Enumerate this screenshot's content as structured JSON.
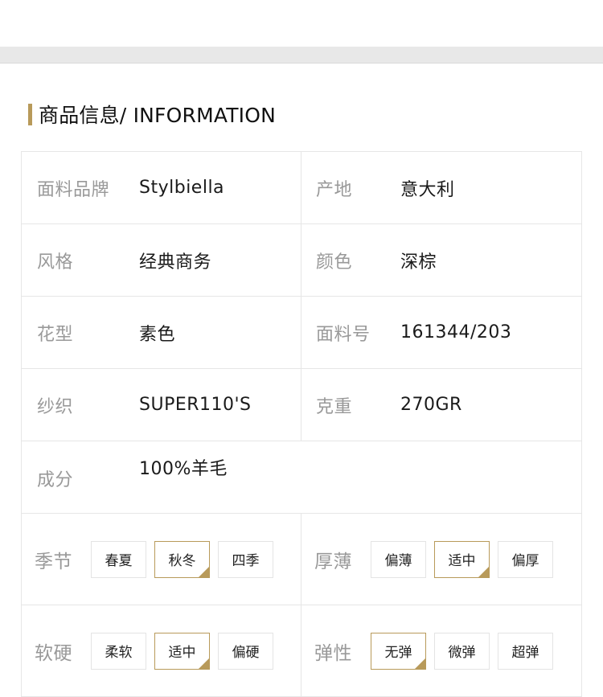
{
  "section": {
    "title": "商品信息/ INFORMATION"
  },
  "colors": {
    "accent": "#b89a5a",
    "label": "#999999",
    "value": "#1a1a1a",
    "border": "#e6e6e6"
  },
  "info_rows": [
    {
      "left_label": "面料品牌",
      "left_value": "Stylbiella",
      "right_label": "产地",
      "right_value": "意大利"
    },
    {
      "left_label": "风格",
      "left_value": "经典商务",
      "right_label": "颜色",
      "right_value": "深棕"
    },
    {
      "left_label": "花型",
      "left_value": "素色",
      "right_label": "面料号",
      "right_value": "161344/203"
    },
    {
      "left_label": "纱织",
      "left_value": "SUPER110'S",
      "right_label": "克重",
      "right_value": "270GR"
    }
  ],
  "composition": {
    "label": "成分",
    "value": "100%羊毛"
  },
  "option_rows": [
    {
      "left": {
        "label": "季节",
        "options": [
          "春夏",
          "秋冬",
          "四季"
        ],
        "selected": "秋冬"
      },
      "right": {
        "label": "厚薄",
        "options": [
          "偏薄",
          "适中",
          "偏厚"
        ],
        "selected": "适中"
      }
    },
    {
      "left": {
        "label": "软硬",
        "options": [
          "柔软",
          "适中",
          "偏硬"
        ],
        "selected": "适中"
      },
      "right": {
        "label": "弹性",
        "options": [
          "无弹",
          "微弹",
          "超弹"
        ],
        "selected": "无弹"
      }
    }
  ]
}
